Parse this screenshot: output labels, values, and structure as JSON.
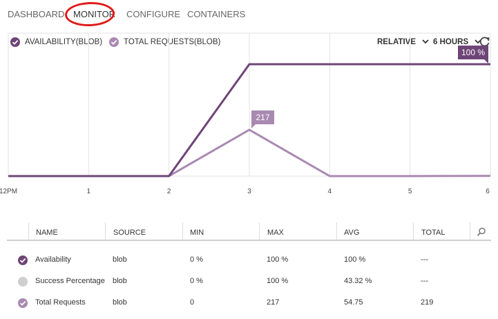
{
  "nav": {
    "items": [
      {
        "label": "DASHBOARD",
        "active": false
      },
      {
        "label": "MONITOR",
        "active": true
      },
      {
        "label": "CONFIGURE",
        "active": false
      },
      {
        "label": "CONTAINERS",
        "active": false
      }
    ]
  },
  "legend": {
    "availability": {
      "label": "AVAILABILITY(BLOB)",
      "color": "#6e4577"
    },
    "total_requests": {
      "label": "TOTAL REQUESTS(BLOB)",
      "color": "#a889b0"
    }
  },
  "controls": {
    "mode_label": "RELATIVE",
    "range_label": "6 HOURS",
    "refresh_icon": "refresh-icon"
  },
  "chart_data": {
    "type": "line",
    "x": [
      "12PM",
      "1",
      "2",
      "3",
      "4",
      "5",
      "6"
    ],
    "series": [
      {
        "name": "Availability(blob)",
        "color": "#6e4577",
        "values": [
          0,
          0,
          0,
          100,
          100,
          100,
          100
        ],
        "callout": "100 %"
      },
      {
        "name": "Total Requests(blob)",
        "color": "#a889b0",
        "values": [
          0,
          0,
          0,
          217,
          0,
          0,
          1
        ],
        "callout": "217"
      }
    ],
    "ylim_availability": [
      0,
      100
    ],
    "ylim_requests": [
      0,
      217
    ],
    "grid": true
  },
  "table": {
    "headers": [
      "NAME",
      "SOURCE",
      "MIN",
      "MAX",
      "AVG",
      "TOTAL"
    ],
    "search_icon": "search-icon",
    "rows": [
      {
        "name": "Availability",
        "source": "blob",
        "min": "0 %",
        "max": "100 %",
        "avg": "100 %",
        "total": "---",
        "status": "checked-dark"
      },
      {
        "name": "Success Percentage",
        "source": "blob",
        "min": "0 %",
        "max": "100 %",
        "avg": "43.32 %",
        "total": "---",
        "status": "unchecked"
      },
      {
        "name": "Total Requests",
        "source": "blob",
        "min": "0",
        "max": "217",
        "avg": "54.75",
        "total": "219",
        "status": "checked-light"
      }
    ]
  }
}
